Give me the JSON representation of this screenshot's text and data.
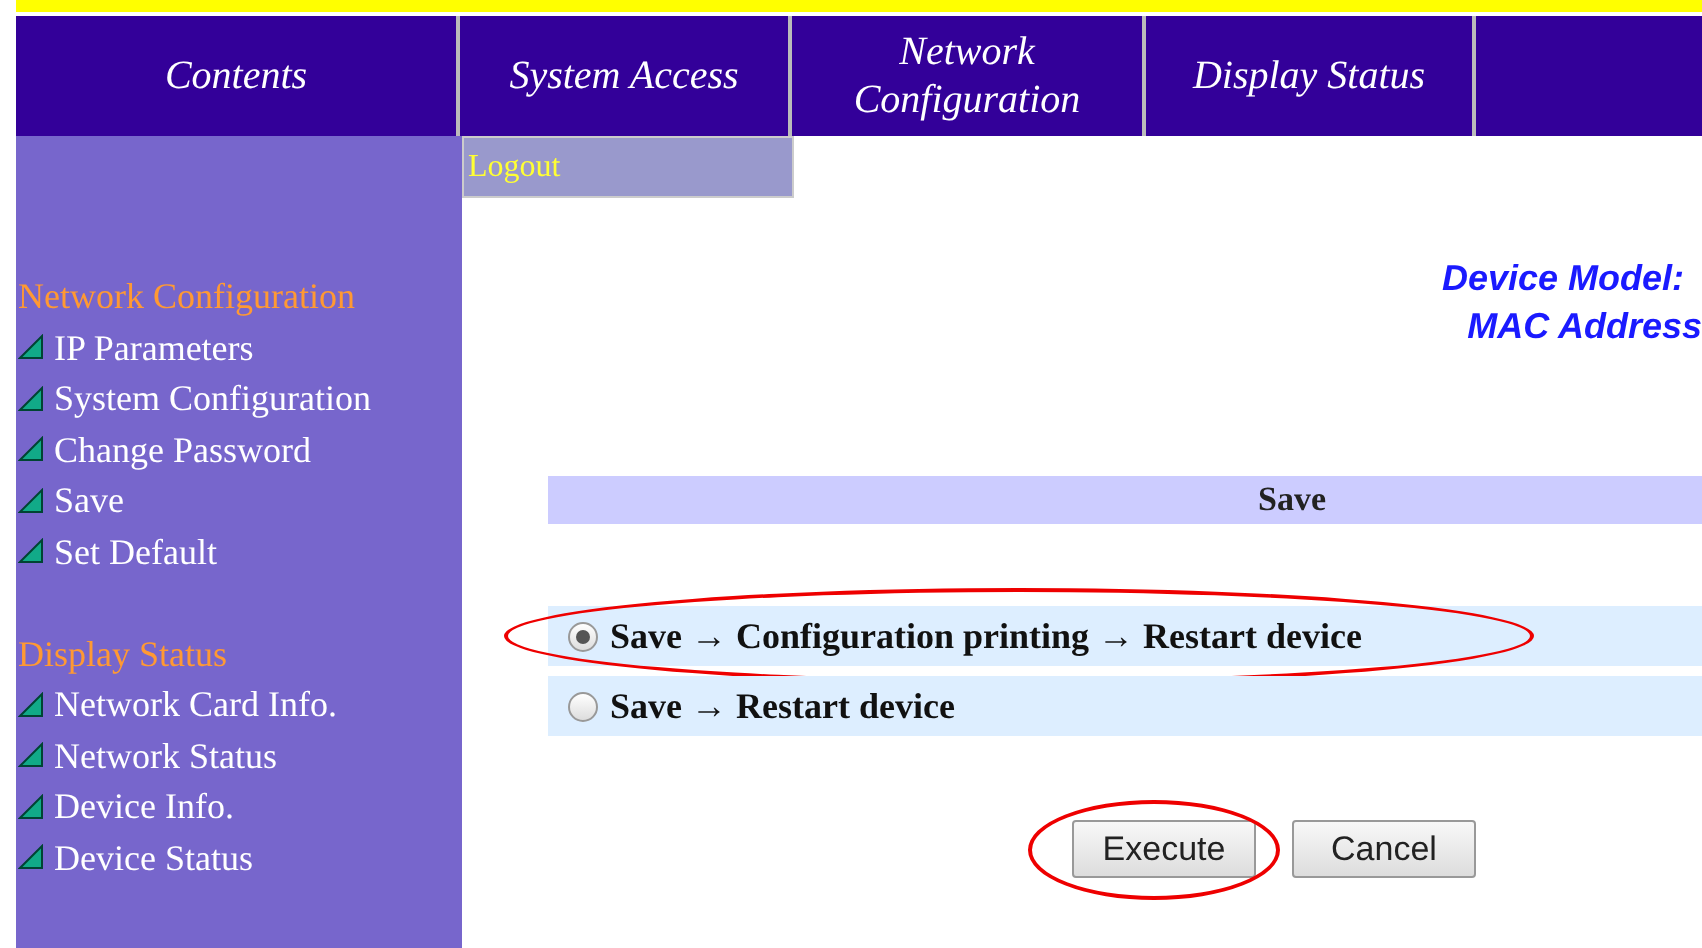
{
  "top_menu": [
    {
      "label": "Contents"
    },
    {
      "label": "System Access"
    },
    {
      "label": "Network Configuration"
    },
    {
      "label": "Display Status"
    }
  ],
  "submenu": {
    "label": "Logout"
  },
  "sidebar": {
    "sections": [
      {
        "title": "Network Configuration",
        "items": [
          "IP Parameters",
          "System Configuration",
          "Change Password",
          "Save",
          "Set Default"
        ]
      },
      {
        "title": "Display Status",
        "items": [
          "Network Card Info.",
          "Network Status",
          "Device Info.",
          "Device Status"
        ]
      }
    ]
  },
  "device_info": [
    "Device Model:",
    "MAC Address"
  ],
  "section_title": "Save",
  "options": [
    {
      "label": "Save → Configuration printing → Restart device",
      "selected": true,
      "highlighted": true
    },
    {
      "label": "Save → Restart device",
      "selected": false,
      "highlighted": false
    }
  ],
  "buttons": [
    {
      "label": "Execute",
      "highlighted": true
    },
    {
      "label": "Cancel",
      "highlighted": false
    }
  ]
}
